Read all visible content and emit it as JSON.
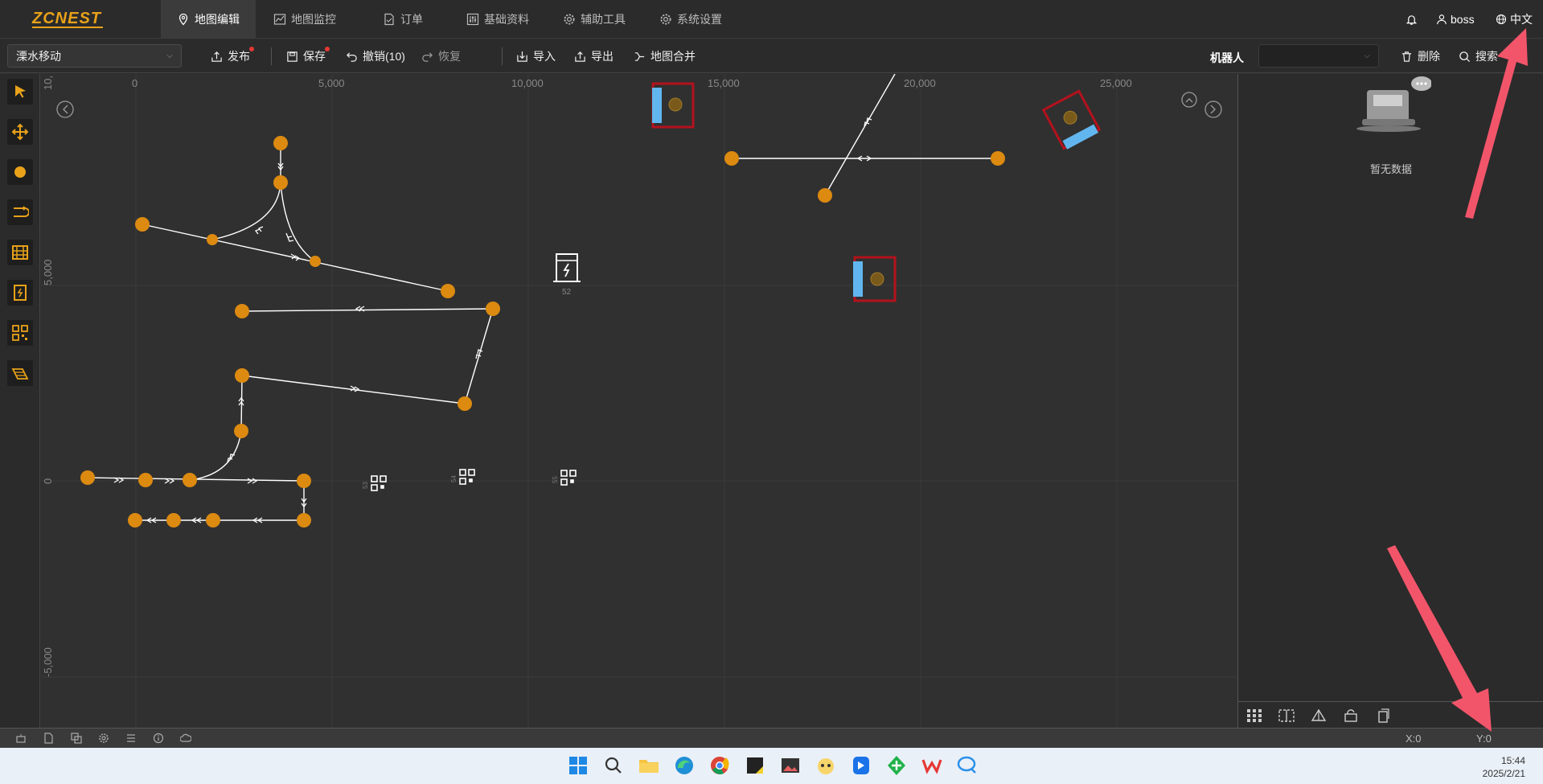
{
  "app": {
    "logo": "ZCNEST",
    "nav_tabs": [
      {
        "label": "地图编辑",
        "icon": "map-pin-icon",
        "active": true
      },
      {
        "label": "地图监控",
        "icon": "line-chart-icon",
        "active": false
      },
      {
        "label": "订单",
        "icon": "document-icon",
        "active": false
      },
      {
        "label": "基础资料",
        "icon": "sliders-icon",
        "active": false
      },
      {
        "label": "辅助工具",
        "icon": "gear-icon",
        "active": false
      },
      {
        "label": "系统设置",
        "icon": "gear-icon",
        "active": false
      }
    ],
    "user": "boss",
    "language": "中文"
  },
  "toolbar": {
    "map_select": "溧水移动",
    "publish": "发布",
    "save": "保存",
    "undo": "撤销(10)",
    "redo": "恢复",
    "import": "导入",
    "export": "导出",
    "merge": "地图合并",
    "robot_label": "机器人",
    "robot_select": "",
    "delete": "删除",
    "search": "搜索"
  },
  "canvas": {
    "x_ticks": [
      "0",
      "5,000",
      "10,000",
      "15,000",
      "20,000",
      "25,000"
    ],
    "y_ticks": [
      "10,",
      "5,000",
      "0",
      "-5,000"
    ],
    "station_label": "52",
    "qr_labels": [
      "53",
      "54",
      "55"
    ]
  },
  "right_panel": {
    "empty_text": "暂无数据"
  },
  "status": {
    "x": "X:0",
    "y": "Y:0"
  },
  "taskbar": {
    "time": "15:44",
    "date": "2025/2/21"
  },
  "colors": {
    "accent": "#e8a21a",
    "node": "#dc8a10",
    "storage_red": "#b3121d",
    "storage_blue": "#62b6ef",
    "annotation_arrow": "#f2556a"
  }
}
